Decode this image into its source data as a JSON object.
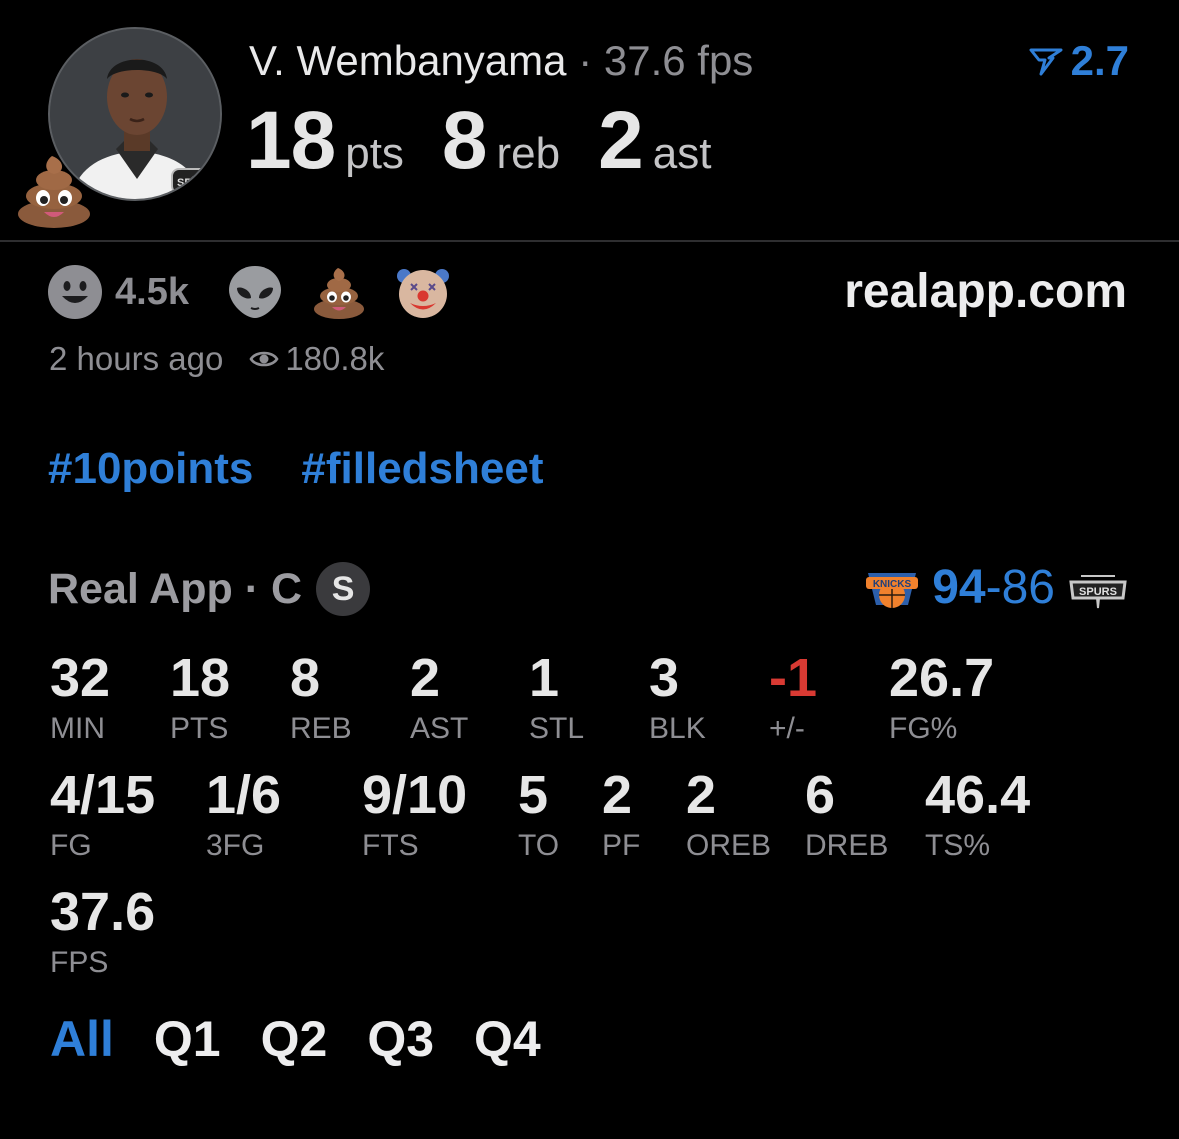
{
  "player": {
    "name": "V. Wembanyama",
    "separator": "·",
    "fps": "37.6 fps",
    "boost": "2.7"
  },
  "headline": {
    "pts_value": "18",
    "pts_unit": "pts",
    "reb_value": "8",
    "reb_unit": "reb",
    "ast_value": "2",
    "ast_unit": "ast"
  },
  "reactions": {
    "smile_count": "4.5k",
    "icons": [
      "smile-icon",
      "alien-icon",
      "poop-icon",
      "clown-icon"
    ]
  },
  "site": "realapp.com",
  "meta": {
    "time": "2 hours ago",
    "views": "180.8k"
  },
  "tags": [
    "#10points",
    "#filledsheet"
  ],
  "game": {
    "source": "Real App · C",
    "badge": "S",
    "score_home": "94",
    "score_dash": "-",
    "score_away": "86"
  },
  "stats_row1": [
    {
      "value": "32",
      "label": "MIN"
    },
    {
      "value": "18",
      "label": "PTS"
    },
    {
      "value": "8",
      "label": "REB"
    },
    {
      "value": "2",
      "label": "AST"
    },
    {
      "value": "1",
      "label": "STL"
    },
    {
      "value": "3",
      "label": "BLK"
    },
    {
      "value": "-1",
      "label": "+/-"
    },
    {
      "value": "26.7",
      "label": "FG%"
    }
  ],
  "stats_row2": [
    {
      "value": "4/15",
      "label": "FG"
    },
    {
      "value": "1/6",
      "label": "3FG"
    },
    {
      "value": "9/10",
      "label": "FTS"
    },
    {
      "value": "5",
      "label": "TO"
    },
    {
      "value": "2",
      "label": "PF"
    },
    {
      "value": "2",
      "label": "OREB"
    },
    {
      "value": "6",
      "label": "DREB"
    },
    {
      "value": "46.4",
      "label": "TS%"
    }
  ],
  "stats_row3": [
    {
      "value": "37.6",
      "label": "FPS"
    }
  ],
  "periods": [
    "All",
    "Q1",
    "Q2",
    "Q3",
    "Q4"
  ],
  "colors": {
    "accent": "#2f7fd8",
    "negative": "#d93a33",
    "muted": "#8e8e93"
  }
}
